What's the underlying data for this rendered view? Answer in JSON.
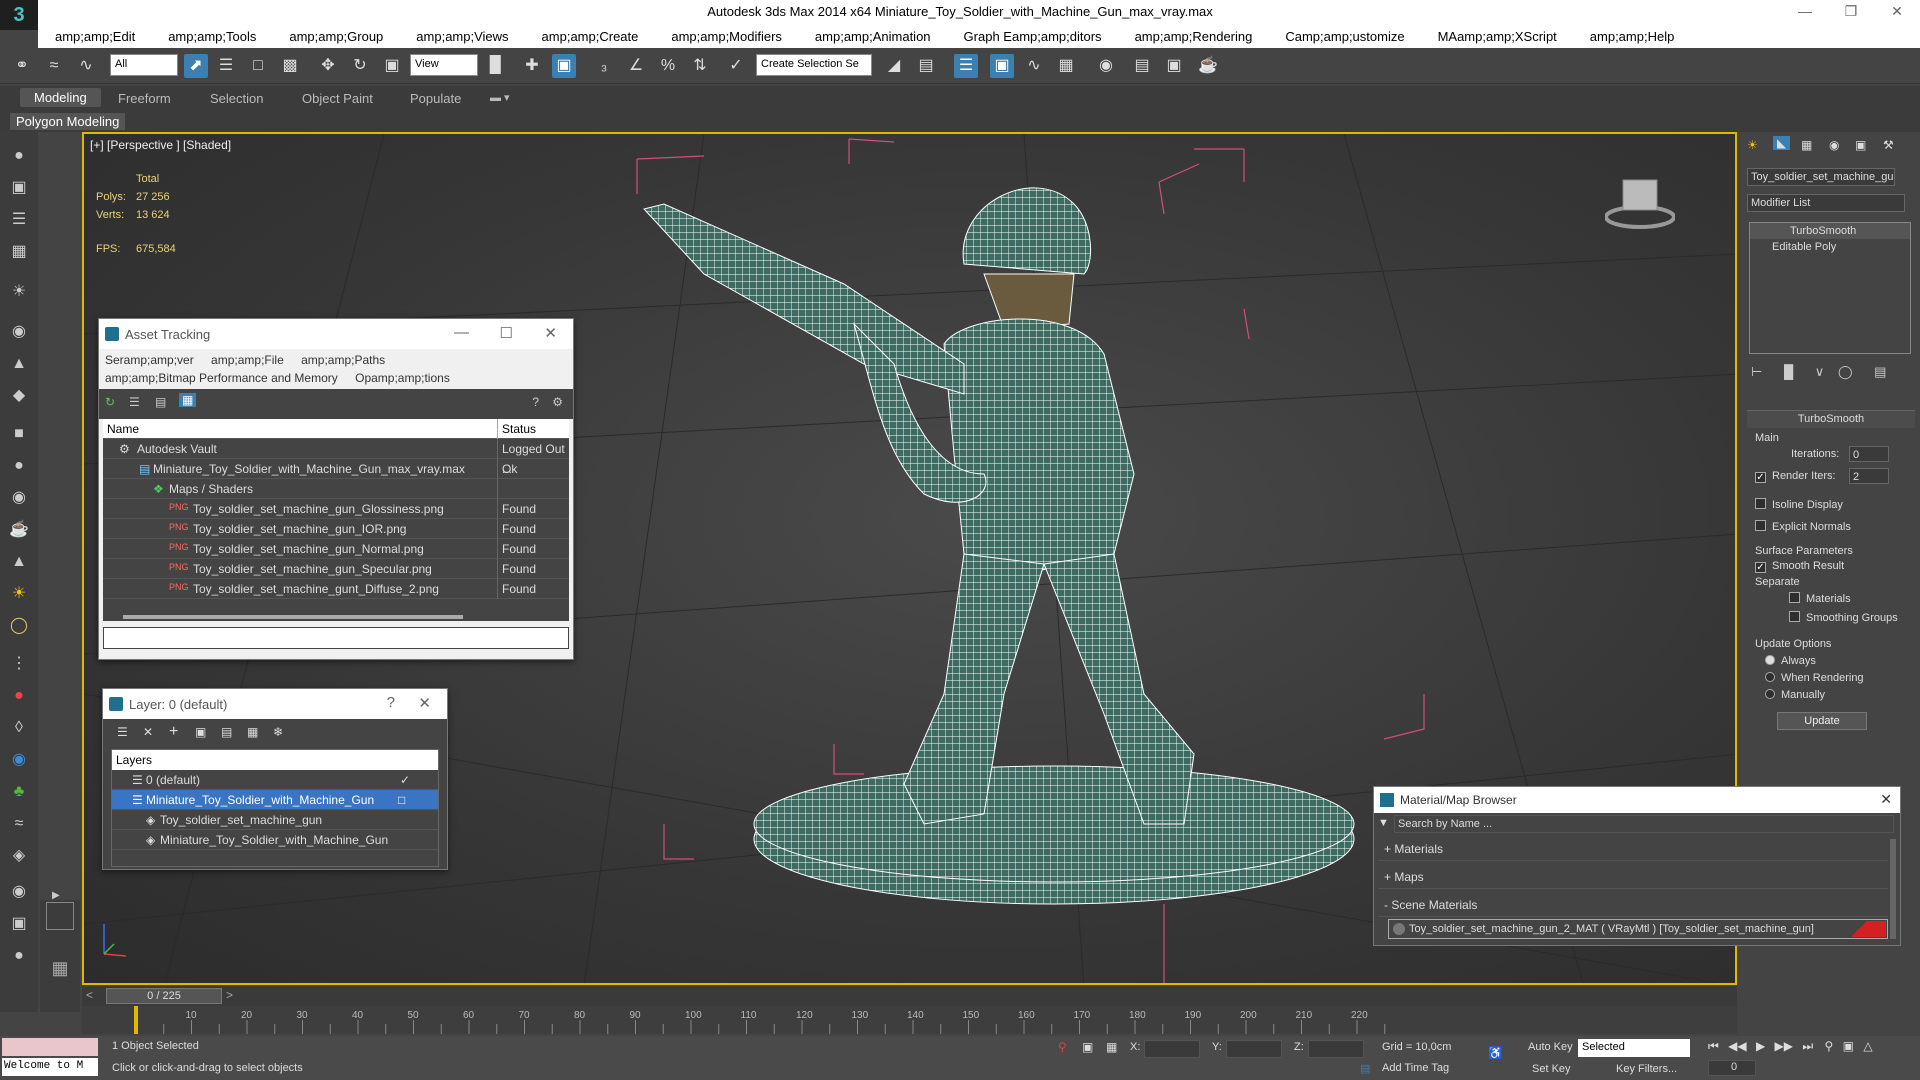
{
  "app": {
    "title": "Autodesk 3ds Max  2014 x64     Miniature_Toy_Soldier_with_Machine_Gun_max_vray.max",
    "logo": "3"
  },
  "menu": [
    "amp;amp;Edit",
    "amp;amp;Tools",
    "amp;amp;Group",
    "amp;amp;Views",
    "amp;amp;Create",
    "amp;amp;Modifiers",
    "amp;amp;Animation",
    "Graph Eamp;amp;ditors",
    "amp;amp;Rendering",
    "Camp;amp;ustomize",
    "MAamp;amp;XScript",
    "amp;amp;Help"
  ],
  "toolbar": {
    "selection_filter": "All",
    "ref_coord": "View",
    "named_selection": "Create Selection Se"
  },
  "ribbon": {
    "tabs": [
      "Modeling",
      "Freeform",
      "Selection",
      "Object Paint",
      "Populate"
    ],
    "panel": "Polygon Modeling"
  },
  "viewport": {
    "label": "[+] [Perspective ] [Shaded]",
    "stats": {
      "total_label": "Total",
      "polys_label": "Polys:",
      "polys": "27 256",
      "verts_label": "Verts:",
      "verts": "13 624",
      "fps_label": "FPS:",
      "fps": "675,584"
    }
  },
  "asset_tracking": {
    "title": "Asset Tracking",
    "menu1": [
      "Seramp;amp;ver",
      "amp;amp;File",
      "amp;amp;Paths"
    ],
    "menu2": [
      "amp;amp;Bitmap Performance and Memory",
      "Opamp;amp;tions"
    ],
    "col_name": "Name",
    "col_status": "Status",
    "rows": [
      {
        "name": "Autodesk Vault",
        "status": "Logged Out ..."
      },
      {
        "name": "Miniature_Toy_Soldier_with_Machine_Gun_max_vray.max",
        "status": "Ok"
      },
      {
        "name": "Maps / Shaders",
        "status": ""
      },
      {
        "name": "Toy_soldier_set_machine_gun_Glossiness.png",
        "status": "Found"
      },
      {
        "name": "Toy_soldier_set_machine_gun_IOR.png",
        "status": "Found"
      },
      {
        "name": "Toy_soldier_set_machine_gun_Normal.png",
        "status": "Found"
      },
      {
        "name": "Toy_soldier_set_machine_gun_Specular.png",
        "status": "Found"
      },
      {
        "name": "Toy_soldier_set_machine_gunt_Diffuse_2.png",
        "status": "Found"
      }
    ]
  },
  "layer_window": {
    "title": "Layer: 0 (default)",
    "help": "?",
    "header": "Layers",
    "rows": [
      {
        "name": "0 (default)"
      },
      {
        "name": "Miniature_Toy_Soldier_with_Machine_Gun"
      },
      {
        "name": "Toy_soldier_set_machine_gun"
      },
      {
        "name": "Miniature_Toy_Soldier_with_Machine_Gun"
      }
    ]
  },
  "command_panel": {
    "object_name": "Toy_soldier_set_machine_gu",
    "modifier_list": "Modifier List",
    "stack": [
      "TurboSmooth",
      "Editable Poly"
    ],
    "rollout": "TurboSmooth",
    "main": "Main",
    "iterations_label": "Iterations:",
    "iterations": "0",
    "render_iters_label": "Render Iters:",
    "render_iters": "2",
    "isoline": "Isoline Display",
    "explicit": "Explicit Normals",
    "surface": "Surface Parameters",
    "smooth_result": "Smooth Result",
    "separate": "Separate",
    "materials": "Materials",
    "smoothing": "Smoothing Groups",
    "update_options": "Update Options",
    "always": "Always",
    "when_rendering": "When Rendering",
    "manually": "Manually",
    "update": "Update"
  },
  "material_browser": {
    "title": "Material/Map Browser",
    "search": "Search by Name ...",
    "sections": [
      "+ Materials",
      "+ Maps",
      "- Scene Materials"
    ],
    "item": "Toy_soldier_set_machine_gun_2_MAT  ( VRayMtl )  [Toy_soldier_set_machine_gun]",
    "swatch": "#d42020"
  },
  "timeline": {
    "frame": "0 / 225",
    "ticks": [
      "10",
      "20",
      "30",
      "40",
      "50",
      "60",
      "70",
      "80",
      "90",
      "100",
      "110",
      "120",
      "130",
      "140",
      "150",
      "160",
      "170",
      "180",
      "190",
      "200",
      "210",
      "220"
    ]
  },
  "status": {
    "selected": "1 Object Selected",
    "prompt": "Click or click-and-drag to select objects",
    "welcome": "Welcome to M",
    "x": "X:",
    "y": "Y:",
    "z": "Z:",
    "grid": "Grid = 10,0cm",
    "auto_key": "Auto Key",
    "set_key": "Set Key",
    "key_mode": "Selected",
    "key_filters": "Key Filters...",
    "add_time_tag": "Add Time Tag",
    "frame_field": "0"
  },
  "colors": {
    "accent": "#3c7fb1",
    "viewport_border": "#e0b800",
    "wire": "#ffffff",
    "bbox": "#d0507a"
  }
}
